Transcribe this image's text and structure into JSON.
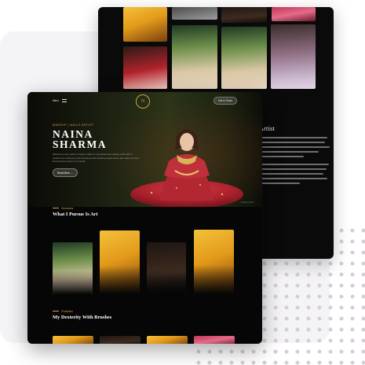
{
  "hero": {
    "menu_label": "Menu",
    "logo_monogram": "N",
    "cta_button": "Get in Touch",
    "kicker": "Makeup | Nails Artist",
    "name_line1": "NAINA",
    "name_line2": "SHARMA",
    "intro": "Welcome to the world of beauty. Naina is a professional makeup artist with a passion for enhancing natural beauty and creating unique looks that make you feel like the best version of yourself.",
    "read_more": "Read More →",
    "credit": "Scroll to know"
  },
  "back_window": {
    "heading": "Artist"
  },
  "services": {
    "label": "Services",
    "title": "What I Pursue Is Art"
  },
  "portfolio": {
    "label": "Portfolio",
    "title": "My Dexterity With Brushes"
  },
  "colors": {
    "accent": "#d2a14a",
    "background": "#060606",
    "dot_pattern": "#d7cdd8"
  }
}
